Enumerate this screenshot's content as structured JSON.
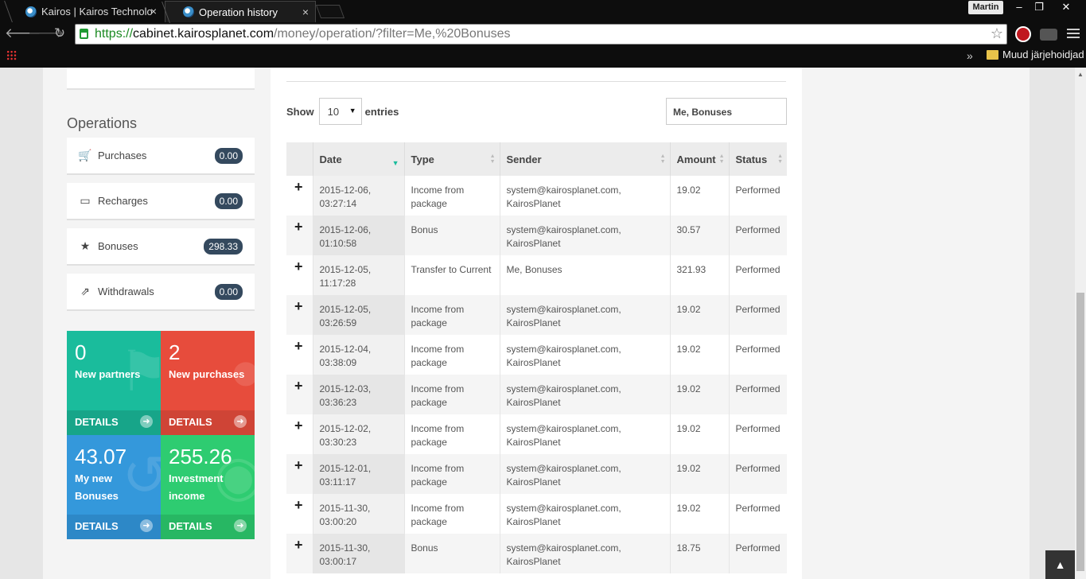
{
  "browser": {
    "tabs": [
      {
        "title": "Kairos | Kairos Technologies"
      },
      {
        "title": "Operation history"
      }
    ],
    "tab_close": "×",
    "user": "Martin",
    "window_buttons": [
      "–",
      "❐",
      "✕"
    ],
    "url": {
      "scheme": "https://",
      "host": "cabinet.kairosplanet.com",
      "path": "/money/operation/?filter=Me,%20Bonuses"
    },
    "bookmarks_more": "»",
    "bookmarks_folder": "Muud järjehoidjad"
  },
  "sidebar": {
    "heading": "Operations",
    "items": [
      {
        "label": "Purchases",
        "value": "0.00",
        "icon": "cart-icon"
      },
      {
        "label": "Recharges",
        "value": "0.00",
        "icon": "credit-card-icon"
      },
      {
        "label": "Bonuses",
        "value": "298.33",
        "icon": "star-icon"
      },
      {
        "label": "Withdrawals",
        "value": "0.00",
        "icon": "share-icon"
      }
    ],
    "tiles": [
      {
        "number": "0",
        "label": "New partners",
        "details": "DETAILS",
        "color": "#1abc9c"
      },
      {
        "number": "2",
        "label": "New purchases",
        "details": "DETAILS",
        "color": "#e74c3c"
      },
      {
        "number": "43.07",
        "label": "My new Bonuses",
        "details": "DETAILS",
        "color": "#3498db"
      },
      {
        "number": "255.26",
        "label": "Investment income",
        "details": "DETAILS",
        "color": "#2ecc71"
      }
    ]
  },
  "table_controls": {
    "show_label": "Show",
    "entries_value": "10",
    "entries_label": "entries",
    "search_value": "Me, Bonuses"
  },
  "table": {
    "columns": [
      "Date",
      "Type",
      "Sender",
      "Amount",
      "Status"
    ],
    "rows": [
      {
        "date1": "2015-12-06,",
        "date2": "03:27:14",
        "type1": "Income from",
        "type2": "package",
        "sender1": "system@kairosplanet.com,",
        "sender2": "KairosPlanet",
        "amount": "19.02",
        "status": "Performed"
      },
      {
        "date1": "2015-12-06,",
        "date2": "01:10:58",
        "type1": "Bonus",
        "type2": "",
        "sender1": "system@kairosplanet.com,",
        "sender2": "KairosPlanet",
        "amount": "30.57",
        "status": "Performed"
      },
      {
        "date1": "2015-12-05,",
        "date2": "11:17:28",
        "type1": "Transfer to Current",
        "type2": "",
        "sender1": "Me, Bonuses",
        "sender2": "",
        "amount": "321.93",
        "status": "Performed"
      },
      {
        "date1": "2015-12-05,",
        "date2": "03:26:59",
        "type1": "Income from",
        "type2": "package",
        "sender1": "system@kairosplanet.com,",
        "sender2": "KairosPlanet",
        "amount": "19.02",
        "status": "Performed"
      },
      {
        "date1": "2015-12-04,",
        "date2": "03:38:09",
        "type1": "Income from",
        "type2": "package",
        "sender1": "system@kairosplanet.com,",
        "sender2": "KairosPlanet",
        "amount": "19.02",
        "status": "Performed"
      },
      {
        "date1": "2015-12-03,",
        "date2": "03:36:23",
        "type1": "Income from",
        "type2": "package",
        "sender1": "system@kairosplanet.com,",
        "sender2": "KairosPlanet",
        "amount": "19.02",
        "status": "Performed"
      },
      {
        "date1": "2015-12-02,",
        "date2": "03:30:23",
        "type1": "Income from",
        "type2": "package",
        "sender1": "system@kairosplanet.com,",
        "sender2": "KairosPlanet",
        "amount": "19.02",
        "status": "Performed"
      },
      {
        "date1": "2015-12-01,",
        "date2": "03:11:17",
        "type1": "Income from",
        "type2": "package",
        "sender1": "system@kairosplanet.com,",
        "sender2": "KairosPlanet",
        "amount": "19.02",
        "status": "Performed"
      },
      {
        "date1": "2015-11-30,",
        "date2": "03:00:20",
        "type1": "Income from",
        "type2": "package",
        "sender1": "system@kairosplanet.com,",
        "sender2": "KairosPlanet",
        "amount": "19.02",
        "status": "Performed"
      },
      {
        "date1": "2015-11-30,",
        "date2": "03:00:17",
        "type1": "Bonus",
        "type2": "",
        "sender1": "system@kairosplanet.com,",
        "sender2": "KairosPlanet",
        "amount": "18.75",
        "status": "Performed"
      }
    ],
    "expand_symbol": "+"
  }
}
